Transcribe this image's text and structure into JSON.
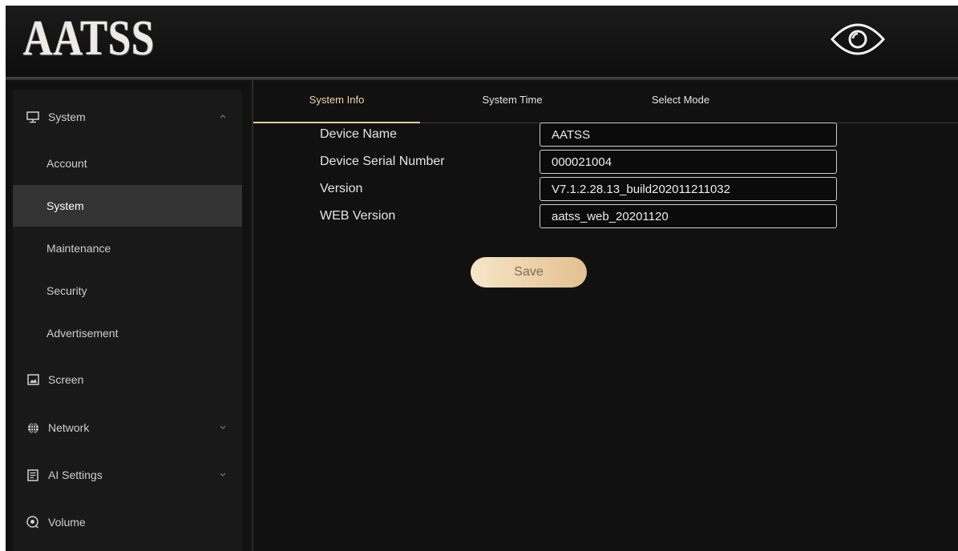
{
  "header": {
    "logo_text": "AATSS",
    "eye_icon": "eye-icon"
  },
  "sidebar": {
    "items": [
      {
        "label": "System",
        "icon": "monitor-icon",
        "chevron": "chevron-up-icon"
      },
      {
        "label": "Account"
      },
      {
        "label": "System",
        "active": true
      },
      {
        "label": "Maintenance"
      },
      {
        "label": "Security"
      },
      {
        "label": "Advertisement"
      },
      {
        "label": "Screen",
        "icon": "image-icon"
      },
      {
        "label": "Network",
        "icon": "globe-icon",
        "chevron": "chevron-down-icon"
      },
      {
        "label": "AI Settings",
        "icon": "document-icon",
        "chevron": "chevron-down-icon"
      },
      {
        "label": "Volume",
        "icon": "volume-icon"
      }
    ]
  },
  "tabs": [
    {
      "label": "System Info",
      "active": true
    },
    {
      "label": "System Time"
    },
    {
      "label": "Select Mode"
    }
  ],
  "form": {
    "fields": [
      {
        "label": "Device Name",
        "value": "AATSS"
      },
      {
        "label": "Device Serial Number",
        "value": "000021004"
      },
      {
        "label": "Version",
        "value": "V7.1.2.28.13_build202011211032"
      },
      {
        "label": "WEB Version",
        "value": "aatss_web_20201120"
      }
    ],
    "save_label": "Save"
  },
  "colors": {
    "accent": "#e9c897",
    "background": "#111111",
    "sidebar": "#191919",
    "active_item": "#333333"
  }
}
